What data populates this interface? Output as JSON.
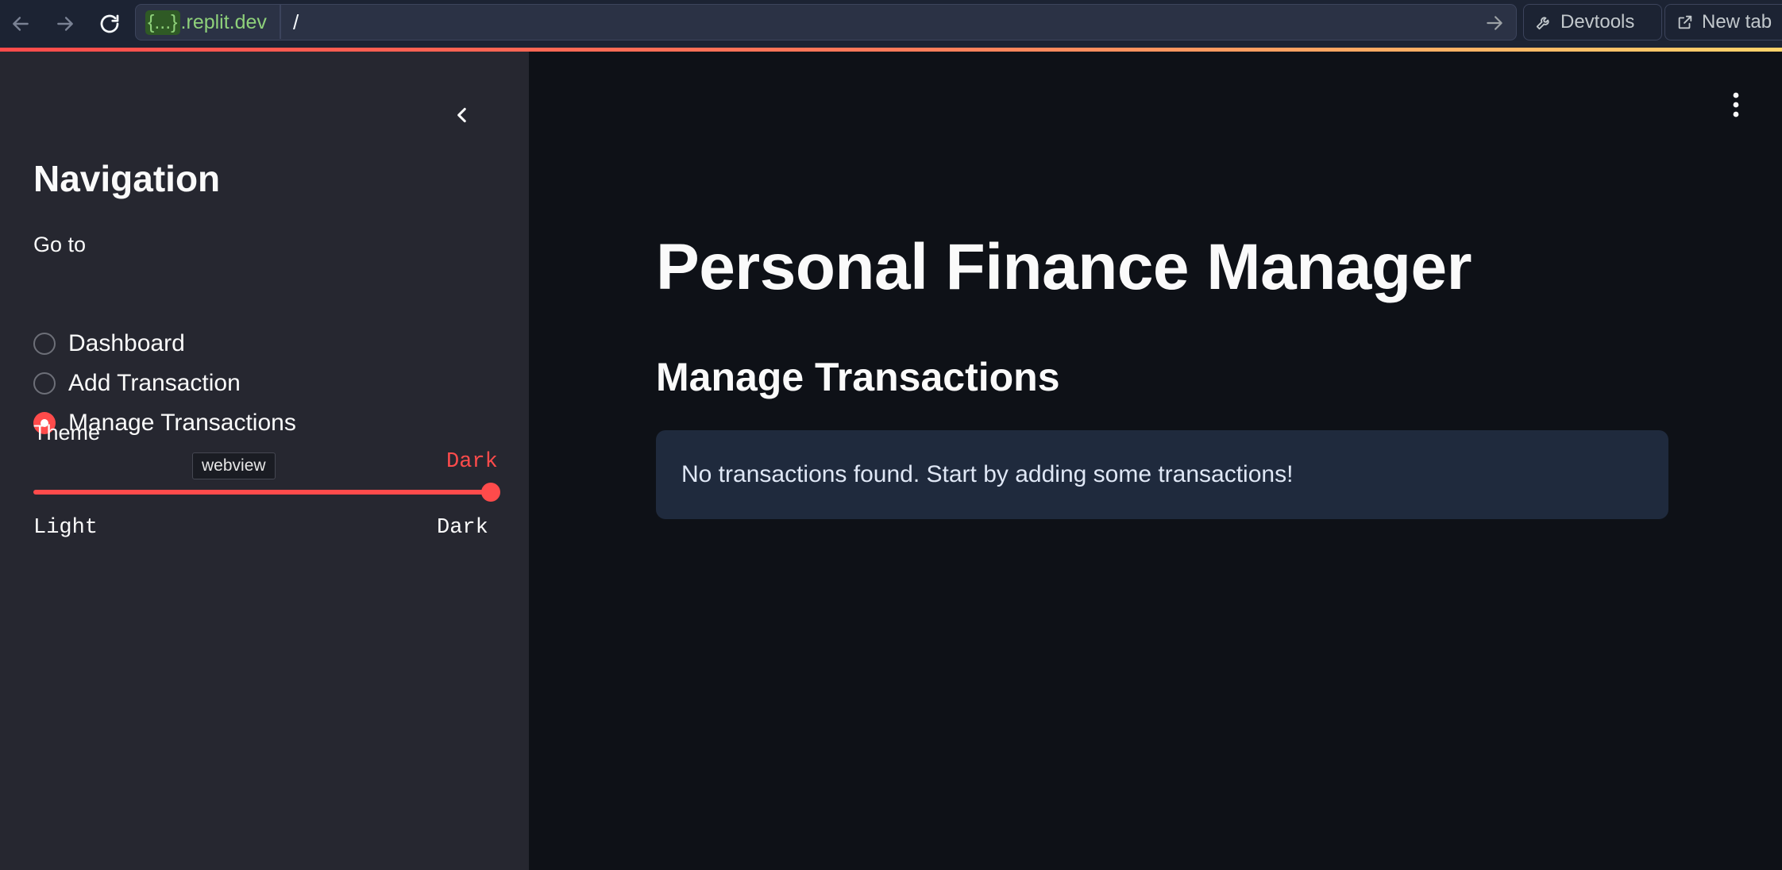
{
  "browser": {
    "domain_braces": "{...}",
    "domain_suffix": ".replit.dev",
    "path": "/",
    "devtools_label": "Devtools",
    "new_tab_label": "New tab",
    "icons": [
      "back-arrow-icon",
      "forward-arrow-icon",
      "reload-icon",
      "go-arrow-icon",
      "wrench-icon",
      "external-link-icon"
    ]
  },
  "sidebar": {
    "title": "Navigation",
    "goto_label": "Go to",
    "options": [
      "Dashboard",
      "Add Transaction",
      "Manage Transactions"
    ],
    "selected": "Manage Transactions",
    "tooltip": "webview",
    "theme": {
      "label": "Theme",
      "value": "Dark",
      "min_label": "Light",
      "max_label": "Dark",
      "position_fraction": 1.0
    }
  },
  "main": {
    "app_title": "Personal Finance Manager",
    "section_title": "Manage Transactions",
    "info_message": "No transactions found. Start by adding some transactions!"
  },
  "colors": {
    "accent": "#ff4b4b",
    "sidebar_bg": "#262730",
    "main_bg": "#0e1117",
    "info_bg": "#1f2a3d",
    "browser_bar_bg": "#1c2333",
    "domain_green": "#8ed07a"
  }
}
